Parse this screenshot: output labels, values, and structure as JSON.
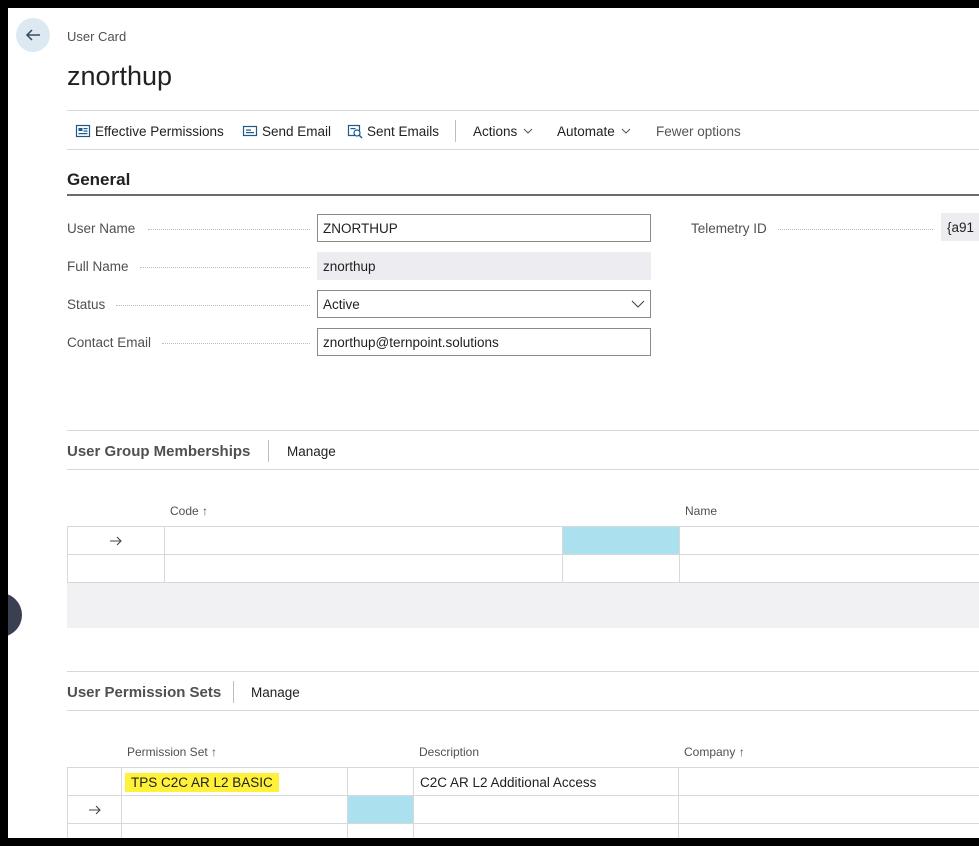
{
  "breadcrumb": "User Card",
  "page_title": "znorthup",
  "toolbar": {
    "effective_permissions": "Effective Permissions",
    "send_email": "Send Email",
    "sent_emails": "Sent Emails",
    "actions": "Actions",
    "automate": "Automate",
    "fewer_options": "Fewer options"
  },
  "general": {
    "title": "General",
    "user_name": {
      "label": "User Name",
      "value": "ZNORTHUP"
    },
    "full_name": {
      "label": "Full Name",
      "value": "znorthup"
    },
    "status": {
      "label": "Status",
      "value": "Active"
    },
    "contact_email": {
      "label": "Contact Email",
      "value": "znorthup@ternpoint.solutions"
    },
    "telemetry_id": {
      "label": "Telemetry ID",
      "value": "{a91"
    }
  },
  "user_group_memberships": {
    "title": "User Group Memberships",
    "manage": "Manage",
    "columns": {
      "code": "Code ↑",
      "name": "Name"
    }
  },
  "user_permission_sets": {
    "title": "User Permission Sets",
    "manage": "Manage",
    "columns": {
      "permission_set": "Permission Set ↑",
      "description": "Description",
      "company": "Company ↑"
    },
    "rows": [
      {
        "permission_set": "TPS C2C AR L2 BASIC",
        "description": "C2C AR L2 Additional Access",
        "company": ""
      }
    ]
  },
  "colors": {
    "selected_cell": "#abe0ee",
    "highlight": "#fff13a",
    "back_button_bg": "#dde9f2"
  }
}
